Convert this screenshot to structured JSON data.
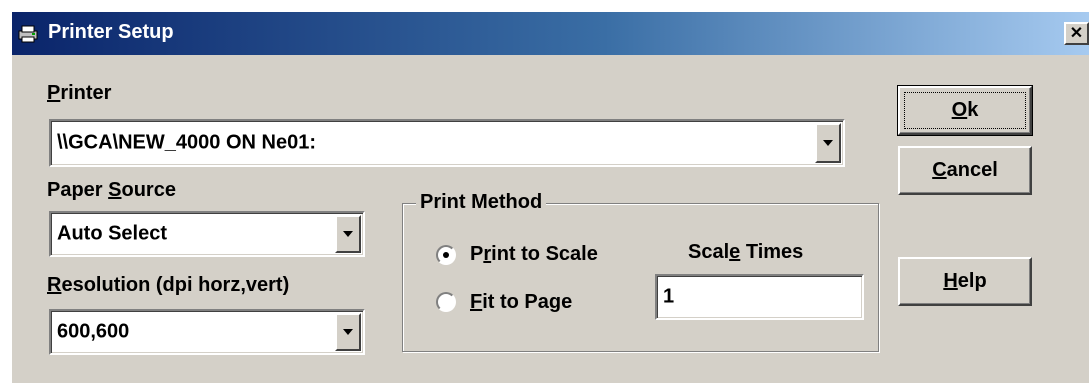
{
  "window": {
    "title": "Printer Setup",
    "icon": "printer-icon",
    "close_glyph": "✕"
  },
  "printer": {
    "label_prefix": "",
    "label_accel": "P",
    "label_rest": "rinter",
    "value": "\\\\GCA\\NEW_4000 ON Ne01:"
  },
  "paper_source": {
    "label_prefix": "Paper ",
    "label_accel": "S",
    "label_rest": "ource",
    "value": "Auto Select"
  },
  "resolution": {
    "label_prefix": "",
    "label_accel": "R",
    "label_rest": "esolution (dpi horz,vert)",
    "value": "600,600"
  },
  "print_method": {
    "title": "Print Method",
    "options": [
      {
        "prefix": "P",
        "accel": "r",
        "rest": "int to Scale",
        "selected": true
      },
      {
        "prefix": "",
        "accel": "F",
        "rest": "it to Page",
        "selected": false
      }
    ],
    "scale_label_prefix": "Scal",
    "scale_label_accel": "e",
    "scale_label_rest": " Times",
    "scale_value": "1"
  },
  "buttons": {
    "ok": {
      "prefix": "",
      "accel": "O",
      "rest": "k"
    },
    "cancel": {
      "prefix": "",
      "accel": "C",
      "rest": "ancel"
    },
    "help": {
      "prefix": "",
      "accel": "H",
      "rest": "elp"
    }
  },
  "colors": {
    "face": "#d4d0c8",
    "title_start": "#0a246a",
    "title_end": "#a6caf0"
  }
}
